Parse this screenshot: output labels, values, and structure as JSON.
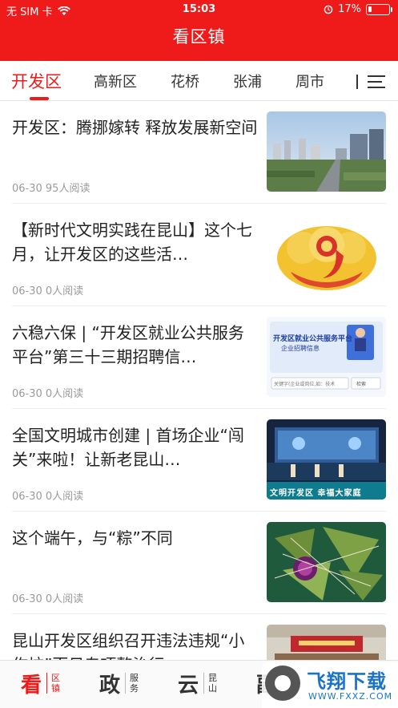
{
  "status": {
    "carrier": "无 SIM 卡",
    "time": "15:03",
    "battery": "17%",
    "battery_level": 0.17
  },
  "header": {
    "title": "看区镇"
  },
  "tabs": [
    {
      "label": "开发区",
      "active": true
    },
    {
      "label": "高新区"
    },
    {
      "label": "花桥"
    },
    {
      "label": "张浦"
    },
    {
      "label": "周市"
    }
  ],
  "news": [
    {
      "title": "开发区：腾挪嫁转 释放发展新空间",
      "meta": "06-30 95人阅读",
      "thumb": "city-skyline"
    },
    {
      "title": "【新时代文明实践在昆山】这个七月，让开发区的这些活…",
      "meta": "06-30 0人阅读",
      "thumb": "logo-graphic"
    },
    {
      "title": "六稳六保 | “开发区就业公共服务平台”第三十三期招聘信…",
      "meta": "06-30 0人阅读",
      "thumb": "job-platform"
    },
    {
      "title": "全国文明城市创建 | 首场企业“闯关”来啦！让新老昆山…",
      "meta": "06-30 0人阅读",
      "thumb": "stage-event"
    },
    {
      "title": "这个端午，与“粽”不同",
      "meta": "06-30 0人阅读",
      "thumb": "zongzi"
    },
    {
      "title": "昆山开发区组织召开违法违规“小作坊”百日专项整治行",
      "meta": "",
      "thumb": "meeting-room"
    }
  ],
  "thumb_text": {
    "job_title": "开发区就业公共服务平台",
    "job_sub": "企业招聘信息",
    "job_search": "关键字(企业或岗位,如：技术",
    "job_search_btn": "检索",
    "stage_banner": "文明开发区 幸福大家庭"
  },
  "bottom_nav": [
    {
      "big": "看",
      "small": "区镇",
      "active": true
    },
    {
      "big": "政",
      "small": "服务"
    },
    {
      "big": "云",
      "small": "昆山"
    },
    {
      "big": "副",
      "small": ""
    }
  ],
  "watermark": {
    "text": "飞翔下载",
    "url": "WWW.FXXZ.COM"
  },
  "colors": {
    "brand_red": "#ef1b1b",
    "watermark_blue": "#1a73c9"
  }
}
